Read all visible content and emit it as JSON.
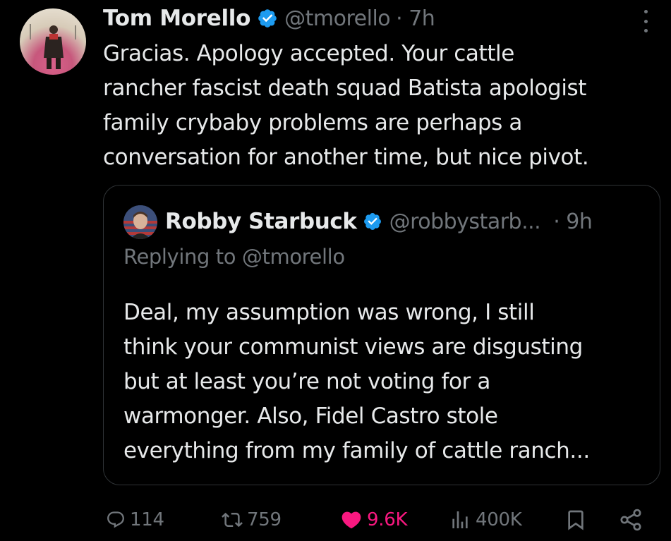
{
  "tweet": {
    "author_name": "Tom Morello",
    "author_handle": "@tmorello",
    "time": "· 7h",
    "text": "Gracias. Apology accepted. Your cattle\nrancher fascist death squad Batista apologist\nfamily crybaby problems are perhaps a\nconversation for another time, but nice pivot."
  },
  "quoted": {
    "author_name": "Robby Starbuck",
    "author_handle": "@robbystarb...",
    "time": "· 9h",
    "reply_to": "Replying to @tmorello",
    "text": "Deal, my assumption was wrong, I still\nthink your communist views are disgusting\nbut at least you’re not voting for a\nwarmonger. Also, Fidel Castro stole\neverything from my family of cattle ranch..."
  },
  "actions": {
    "replies": "114",
    "reposts": "759",
    "likes": "9.6K",
    "views": "400K"
  },
  "colors": {
    "verified": "#1d9bf0",
    "like": "#f91880",
    "muted": "#71767b"
  },
  "icons": [
    "more-icon",
    "verified-icon",
    "reply-icon",
    "repost-icon",
    "heart-icon",
    "views-icon",
    "bookmark-icon",
    "share-icon"
  ]
}
